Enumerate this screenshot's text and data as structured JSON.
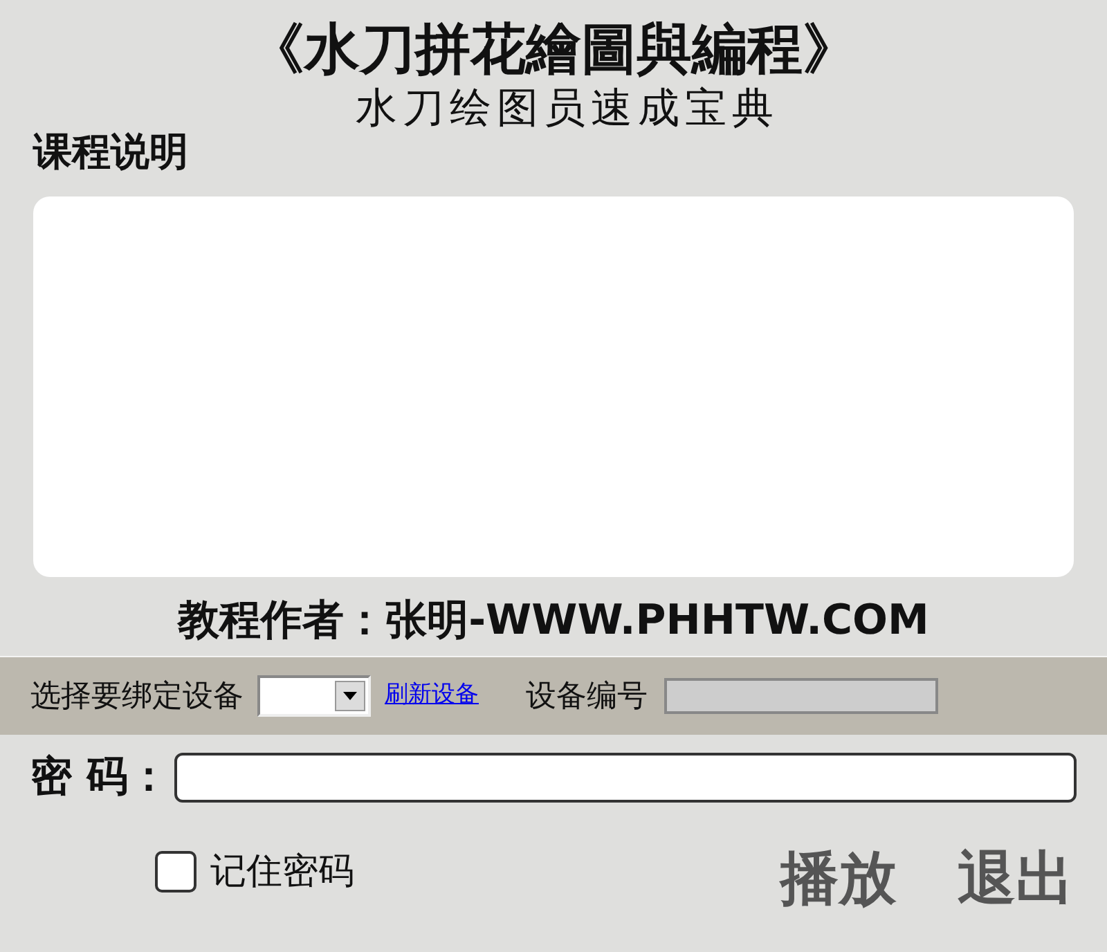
{
  "header": {
    "title": "《水刀拼花繪圖與編程》",
    "subtitle": "水刀绘图员速成宝典"
  },
  "course": {
    "heading": "课程说明"
  },
  "author": "教程作者：张明-WWW.PHHTW.COM",
  "device_bar": {
    "select_label": "选择要绑定设备",
    "refresh_link": "刷新设备",
    "serial_label": "设备编号"
  },
  "password": {
    "label": "密 码："
  },
  "remember": {
    "label": "记住密码",
    "checked": false
  },
  "buttons": [
    "播放",
    "退出"
  ]
}
